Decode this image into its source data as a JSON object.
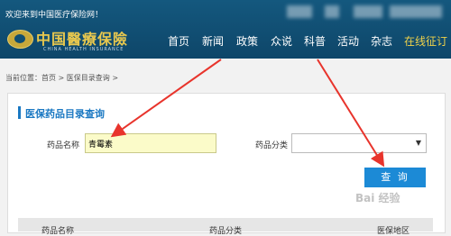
{
  "topbar": {
    "welcome": "欢迎来到中国医疗保险网！",
    "logo_text": "中国醫療保險",
    "logo_subtitle": "CHINA HEALTH INSURANCE"
  },
  "nav": {
    "items": [
      {
        "label": "首页"
      },
      {
        "label": "新闻"
      },
      {
        "label": "政策"
      },
      {
        "label": "众说"
      },
      {
        "label": "科普"
      },
      {
        "label": "活动"
      },
      {
        "label": "杂志"
      },
      {
        "label": "在线征订"
      }
    ]
  },
  "breadcrumb": {
    "text": "当前位置：首页  >  医保目录查询  >"
  },
  "panel": {
    "title": "医保药品目录查询"
  },
  "form": {
    "drug_name_label": "药品名称",
    "drug_name_value": "青霉素",
    "category_label": "药品分类",
    "category_value": "",
    "search_button": "查 询"
  },
  "table": {
    "headers": [
      "药品名称",
      "药品分类",
      "医保地区"
    ]
  },
  "watermark": "Bai 经验",
  "colors": {
    "header_bg": "#14587e",
    "accent_blue": "#1a78c2",
    "button_blue": "#1c8ad6",
    "highlight_nav": "#f0d24a",
    "annotation_arrow": "#e8342c"
  }
}
